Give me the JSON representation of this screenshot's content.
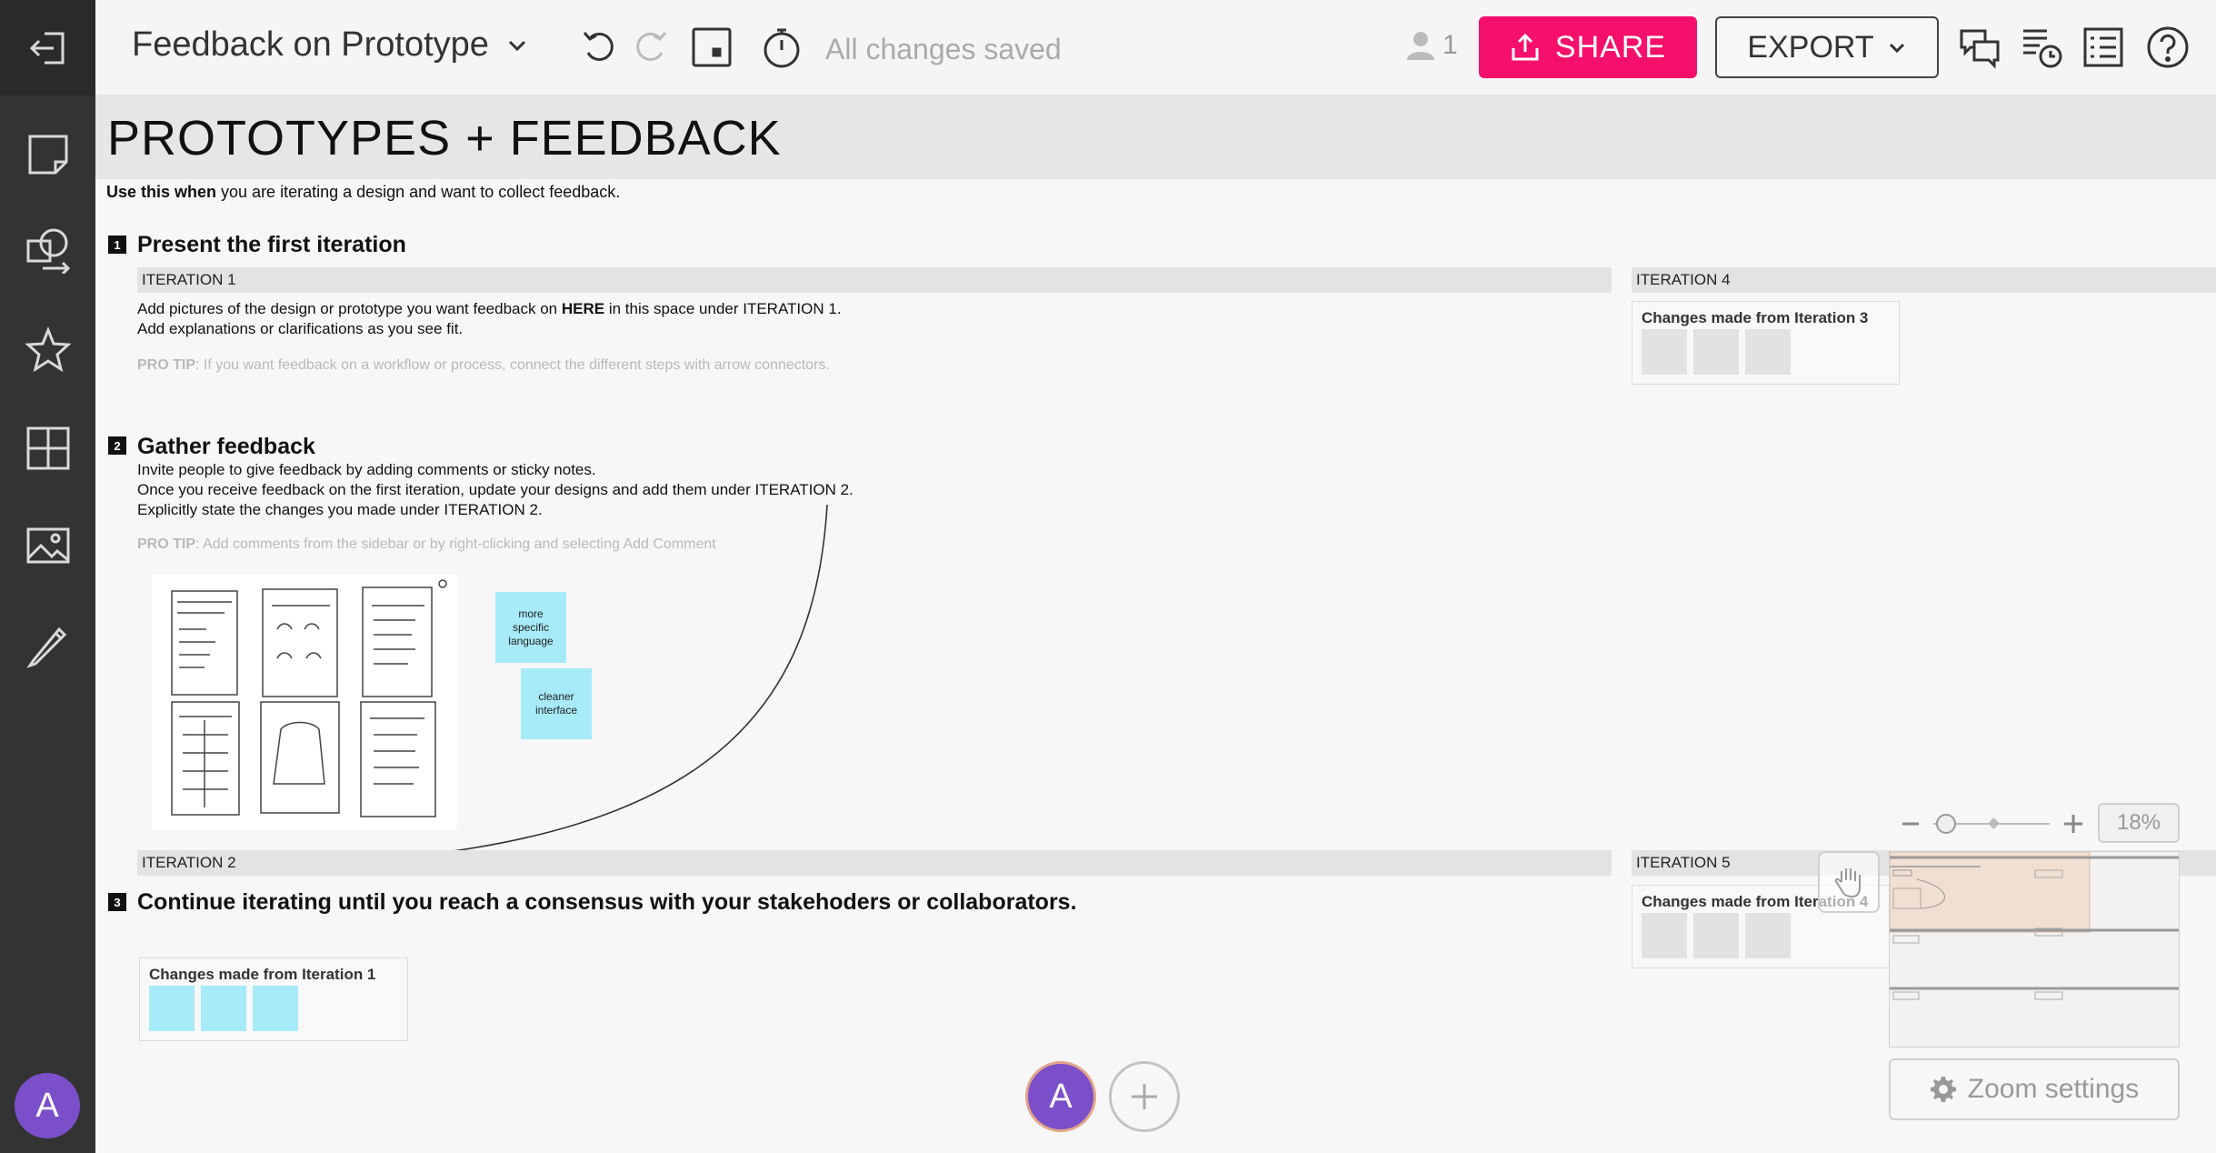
{
  "toolbar": {
    "board_title": "Feedback on Prototype",
    "save_status": "All changes saved",
    "collaborator_count": "1",
    "share_label": "SHARE",
    "export_label": "EXPORT"
  },
  "sidebar": {
    "user_initial": "A",
    "items": [
      "exit-icon",
      "sticky-note-icon",
      "shape-icon",
      "star-icon",
      "grid-icon",
      "image-icon",
      "pen-icon"
    ]
  },
  "board": {
    "title": "PROTOTYPES + FEEDBACK",
    "intro_bold": "Use this when",
    "intro_rest": " you are iterating a design and want to collect feedback.",
    "step1": {
      "number": "1",
      "title": "Present the first iteration",
      "line1_pre": "Add pictures of the design or prototype you want feedback on ",
      "line1_bold": "HERE",
      "line1_post": " in this space under ITERATION 1.",
      "line2": "Add explanations or clarifications as you see fit.",
      "tip_bold": "PRO TIP",
      "tip_rest": ": If you want feedback on a workflow or process, connect the different steps with arrow connectors."
    },
    "step2": {
      "number": "2",
      "title": "Gather feedback",
      "line1": "Invite people to give feedback by adding comments or sticky notes.",
      "line2": "Once you receive feedback on the first iteration, update your designs and add them under ITERATION 2.",
      "line3": "Explicitly state the changes you made under ITERATION 2.",
      "tip_bold": "PRO TIP",
      "tip_rest": ": Add comments from the sidebar or by right-clicking and selecting Add Comment"
    },
    "step3": {
      "number": "3",
      "title": "Continue iterating until you reach a consensus with your stakehoders or collaborators."
    },
    "iterations": {
      "iter1": "ITERATION 1",
      "iter2": "ITERATION 2",
      "iter4": "ITERATION 4",
      "iter5": "ITERATION 5"
    },
    "changes": {
      "from1": "Changes made from Iteration 1",
      "from3": "Changes made from Iteration 3",
      "from4": "Changes made from Iteration 4"
    },
    "stickies": {
      "note1": "more specific language",
      "note2": "cleaner interface"
    },
    "colors": {
      "sticky": "#a6ebf7",
      "card_square": "#a6ebf7",
      "grey_square": "#e2e2e2",
      "share": "#f4106b",
      "avatar": "#7b4fc9"
    }
  },
  "zoom": {
    "percent": "18%",
    "settings_label": "Zoom settings"
  },
  "bottom": {
    "user_initial": "A"
  }
}
